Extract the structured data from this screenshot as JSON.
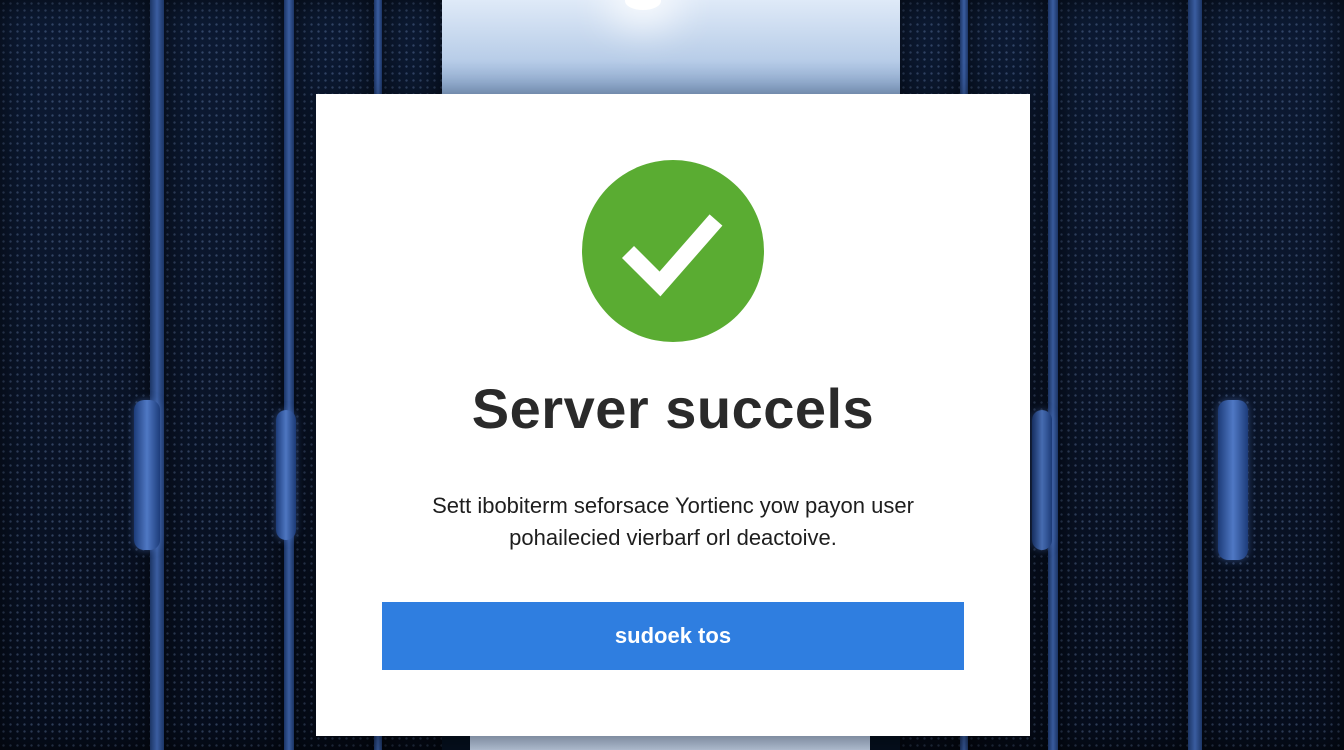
{
  "dialog": {
    "icon": "checkmark-icon",
    "title": "Server succels",
    "message_line1": "Sett ibobiterm seforsace Yortienc yow payon user",
    "message_line2": "pohailecied vierbarf orl deactoive.",
    "button_label": "sudoek tos"
  },
  "colors": {
    "success_green": "#5aac32",
    "button_blue": "#2f7ee0",
    "title_text": "#2a2a2a"
  }
}
